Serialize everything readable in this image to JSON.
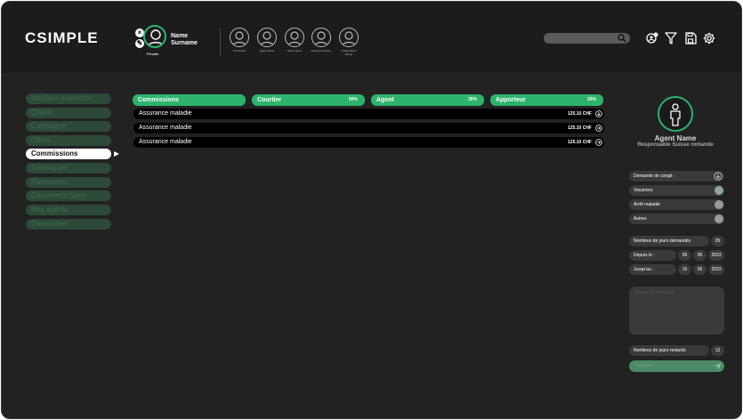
{
  "app": {
    "logo": "CSIMPLE"
  },
  "profile": {
    "first_name": "Name",
    "last_name": "Surname",
    "tag": "Private",
    "accent": "#2db36b"
  },
  "team_avatars": [
    {
      "label": "Prof Name"
    },
    {
      "label": "Agent Name"
    },
    {
      "label": "Name Agent"
    },
    {
      "label": "Employee Name"
    },
    {
      "label": "Independent Name"
    }
  ],
  "search": {
    "placeholder": ""
  },
  "sidebar": {
    "items": [
      {
        "label": "Interface protection",
        "active": false
      },
      {
        "label": "Clients",
        "active": false
      },
      {
        "label": "Campagne",
        "active": false
      },
      {
        "label": "Offres",
        "active": false
      },
      {
        "label": "Commissions",
        "active": true
      },
      {
        "label": "Statistiques",
        "active": false
      },
      {
        "label": "Partenaires",
        "active": false
      },
      {
        "label": "Documents types",
        "active": false
      },
      {
        "label": "Mes agents",
        "active": false
      },
      {
        "label": "Paramètres",
        "active": false
      }
    ]
  },
  "commissions": {
    "headers": [
      {
        "label": "Commissions",
        "pct": ""
      },
      {
        "label": "Courtier",
        "pct": "50%"
      },
      {
        "label": "Agent",
        "pct": "30%"
      },
      {
        "label": "Apporteur",
        "pct": "20%"
      }
    ],
    "rows": [
      {
        "label": "Assurance maladie",
        "amount": "125.10 CHF",
        "icon": "download-icon"
      },
      {
        "label": "Assurance maladie",
        "amount": "125.10 CHF",
        "icon": "arrow-right-icon"
      },
      {
        "label": "Assurance maladie",
        "amount": "125.10 CHF",
        "icon": "arrow-right-icon"
      }
    ]
  },
  "agent_panel": {
    "name": "Agent Name",
    "role": "Responsable Suisse romande",
    "leave_request_label": "Demande de congé",
    "options": [
      {
        "label": "Vacances",
        "color": "#8fa597"
      },
      {
        "label": "Arrêt maladie",
        "color": "#9a9a9a"
      },
      {
        "label": "Autres",
        "color": "#9a9a9a"
      }
    ],
    "days_requested_label": "Nombres de jours demandés",
    "days_requested_value": "05",
    "from_label": "Depuis le :",
    "from_day": "05",
    "from_month": "05",
    "from_year": "2023",
    "to_label": "Jusqu'au :",
    "to_day": "15",
    "to_month": "06",
    "to_year": "2023",
    "comment_placeholder": "Ajouter un message",
    "days_left_label": "Nombres de jours restants",
    "days_left_value": "12",
    "submit_label": "Envoyer"
  }
}
